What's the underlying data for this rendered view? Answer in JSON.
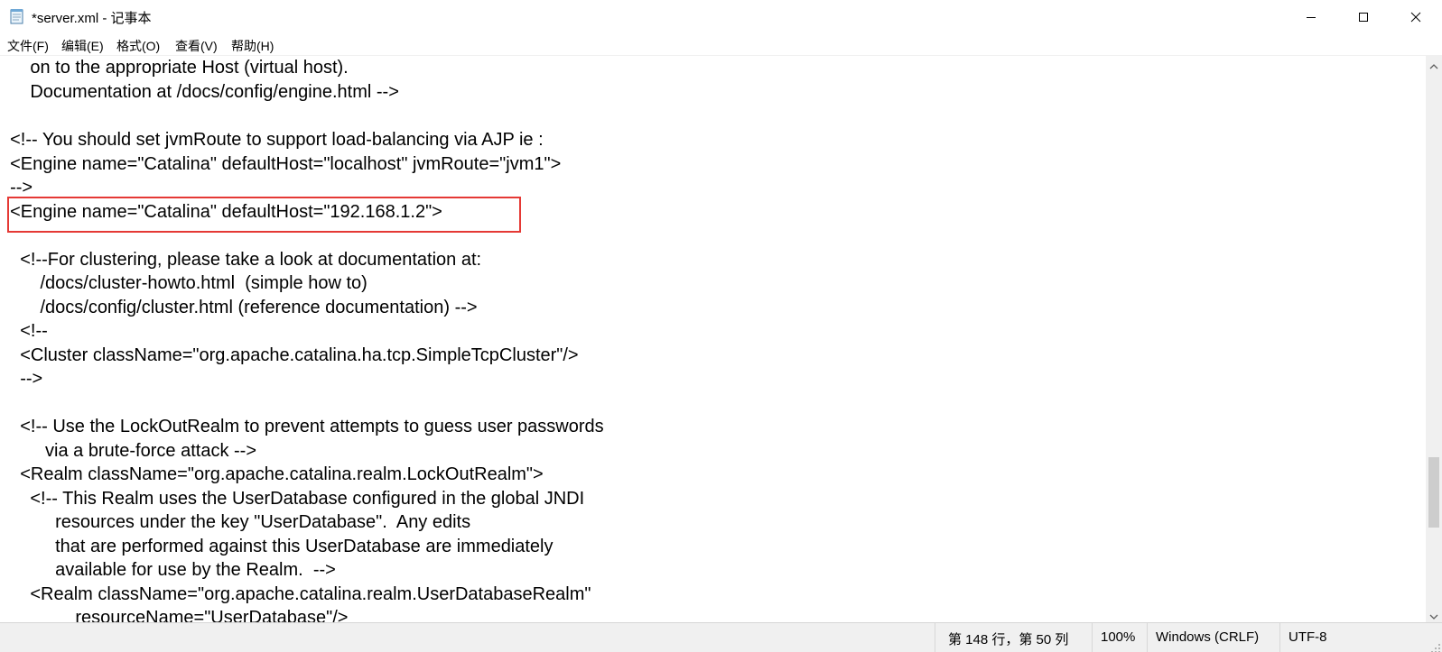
{
  "window": {
    "title": "*server.xml - 记事本",
    "app_icon": "notepad-icon",
    "controls": [
      "minimize-icon",
      "maximize-icon",
      "close-icon"
    ]
  },
  "menu": [
    {
      "label": "文件(F)"
    },
    {
      "label": "编辑(E)"
    },
    {
      "label": "格式(O)"
    },
    {
      "label": "查看(V)"
    },
    {
      "label": "帮助(H)"
    }
  ],
  "editor": {
    "lines": [
      "      on to the appropriate Host (virtual host).",
      "      Documentation at /docs/config/engine.html -->",
      "",
      "  <!-- You should set jvmRoute to support load-balancing via AJP ie :",
      "  <Engine name=\"Catalina\" defaultHost=\"localhost\" jvmRoute=\"jvm1\">",
      "  -->",
      "  <Engine name=\"Catalina\" defaultHost=\"192.168.1.2\">",
      "",
      "    <!--For clustering, please take a look at documentation at:",
      "        /docs/cluster-howto.html  (simple how to)",
      "        /docs/config/cluster.html (reference documentation) -->",
      "    <!--",
      "    <Cluster className=\"org.apache.catalina.ha.tcp.SimpleTcpCluster\"/>",
      "    -->",
      "",
      "    <!-- Use the LockOutRealm to prevent attempts to guess user passwords",
      "         via a brute-force attack -->",
      "    <Realm className=\"org.apache.catalina.realm.LockOutRealm\">",
      "      <!-- This Realm uses the UserDatabase configured in the global JNDI",
      "           resources under the key \"UserDatabase\".  Any edits",
      "           that are performed against this UserDatabase are immediately",
      "           available for use by the Realm.  -->",
      "      <Realm className=\"org.apache.catalina.realm.UserDatabaseRealm\"",
      "               resourceName=\"UserDatabase\"/>"
    ]
  },
  "status": {
    "position": "第 148 行，第 50 列",
    "zoom": "100%",
    "line_ending": "Windows (CRLF)",
    "encoding": "UTF-8"
  }
}
